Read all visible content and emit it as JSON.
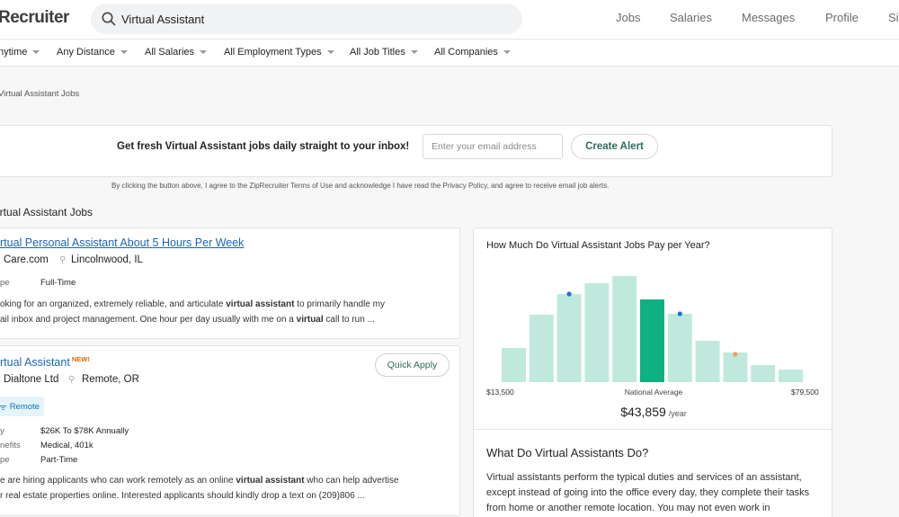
{
  "header": {
    "logo": "Recruiter",
    "search_value": "Virtual Assistant",
    "nav": [
      "Jobs",
      "Salaries",
      "Messages",
      "Profile",
      "Si"
    ]
  },
  "filters": [
    "nytime",
    "Any Distance",
    "All Salaries",
    "All Employment Types",
    "All Job Titles",
    "All Companies"
  ],
  "breadcrumb": "Virtual Assistant Jobs",
  "alert": {
    "text": "Get fresh Virtual Assistant jobs daily straight to your inbox!",
    "email_placeholder": "Enter your email address",
    "button": "Create Alert",
    "disclaimer": "By clicking the button above, I agree to the ZipRecruiter Terms of Use and acknowledge I have read the Privacy Policy, and agree to receive email job alerts."
  },
  "section_title": "irtual Assistant Jobs",
  "jobs": [
    {
      "title": "rtual Personal Assistant About 5 Hours Per Week",
      "company": "Care.com",
      "location": "Lincolnwood, IL",
      "type_label": "pe",
      "type_value": "Full-Time",
      "snippet_1a": "oking for an organized, extremely reliable, and articulate ",
      "snippet_1b": "virtual assistant",
      "snippet_1c": " to primarily handle my",
      "snippet_2a": "ail inbox and project management. One hour per day usually with me on a ",
      "snippet_2b": "virtual",
      "snippet_2c": " call to run ..."
    },
    {
      "title": "rtual Assistant",
      "new_tag": "NEW!",
      "quick_apply": "Quick Apply",
      "company": "Dialtone Ltd",
      "location": "Remote, OR",
      "remote_tag": "Remote",
      "pay_label": "y",
      "pay_value": "$26K To $78K Annually",
      "benefits_label": "nefits",
      "benefits_value": "Medical,  401k",
      "type_label": "pe",
      "type_value": "Part-Time",
      "snippet_1a": "e are hiring applicants who can work remotely as an online ",
      "snippet_1b": "virtual assistant",
      "snippet_1c": " who can help advertise",
      "snippet_2a": "r real estate properties online. Interested applicants should kindly drop a text on (209)806 ..."
    }
  ],
  "pay_panel": {
    "title": "How Much Do Virtual Assistant Jobs Pay per Year?",
    "min_label": "$13,500",
    "max_label": "$79,500",
    "avg_label": "National Average",
    "avg_value": "$43,859",
    "avg_unit": "/year"
  },
  "chart_data": {
    "type": "bar",
    "values": [
      38,
      75,
      98,
      110,
      118,
      92,
      76,
      46,
      33,
      19,
      14
    ],
    "highlight_index": 5,
    "markers": [
      {
        "bar": 2,
        "level": 98,
        "color": "#1d73d6"
      },
      {
        "bar": 6,
        "level": 76,
        "color": "#1d73d6"
      },
      {
        "bar": 8,
        "level": 31,
        "color": "#e8a05c"
      }
    ],
    "xlabel_min": "$13,500",
    "xlabel_max": "$79,500",
    "colors": {
      "bar": "#c0e9dd",
      "highlight": "#0fb082"
    }
  },
  "about": {
    "title": "What Do Virtual Assistants Do?",
    "text": "Virtual assistants perform the typical duties and services of an assistant, except instead of going into the office every day, they complete their tasks from home or another remote location. You may not even work in"
  }
}
